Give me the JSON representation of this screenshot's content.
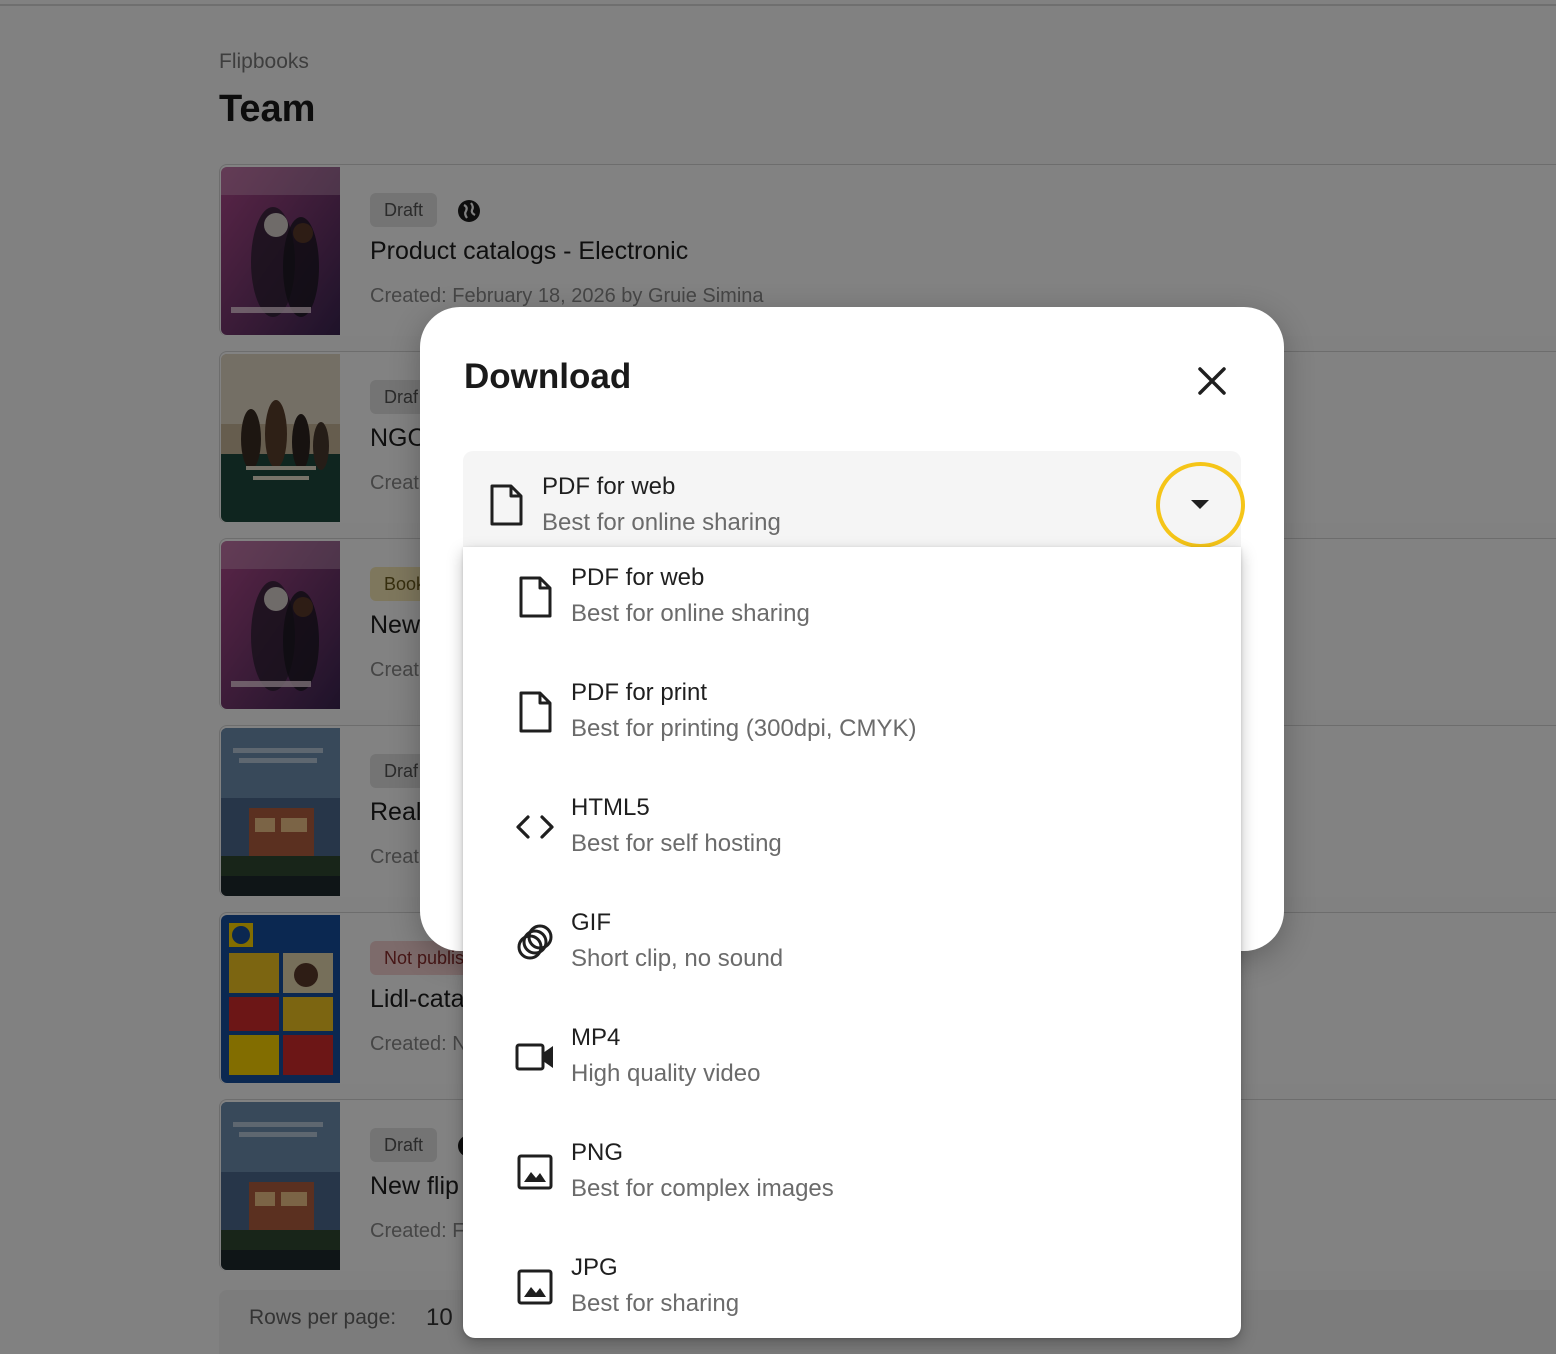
{
  "header": {
    "breadcrumb": "Flipbooks",
    "title": "Team"
  },
  "flipbooks": [
    {
      "status": "Draft",
      "status_type": "draft",
      "title": "Product catalogs - Electronic",
      "meta": "Created: February 18, 2026 by Gruie Simina",
      "has_globe": true,
      "cover": "electronics"
    },
    {
      "status": "Draf",
      "status_type": "draft",
      "title": "NGO",
      "meta": "Creat",
      "has_globe": false,
      "cover": "charity"
    },
    {
      "status": "Book",
      "status_type": "book",
      "title": "New",
      "meta": "Creat",
      "has_globe": false,
      "cover": "electronics"
    },
    {
      "status": "Draf",
      "status_type": "draft",
      "title": "Real",
      "meta": "Creat",
      "has_globe": false,
      "cover": "realty"
    },
    {
      "status": "Not publis",
      "status_type": "notpub",
      "title": "Lidl-cata",
      "meta": "Created: N",
      "has_globe": false,
      "cover": "lidl"
    },
    {
      "status": "Draft",
      "status_type": "draft",
      "title": "New flip",
      "meta": "Created: F",
      "has_globe": true,
      "cover": "realty"
    }
  ],
  "pagination": {
    "rows_label": "Rows per page:",
    "rows_value": "10"
  },
  "dialog": {
    "title": "Download",
    "selected": {
      "title": "PDF for web",
      "subtitle": "Best for online sharing",
      "icon": "file-icon"
    },
    "highlight_color": "#f5c518",
    "options": [
      {
        "title": "PDF for web",
        "subtitle": "Best for online sharing",
        "icon": "file-icon"
      },
      {
        "title": "PDF for print",
        "subtitle": "Best for printing (300dpi, CMYK)",
        "icon": "file-icon"
      },
      {
        "title": "HTML5",
        "subtitle": "Best for self hosting",
        "icon": "code-icon"
      },
      {
        "title": "GIF",
        "subtitle": "Short clip, no sound",
        "icon": "gif-icon"
      },
      {
        "title": "MP4",
        "subtitle": "High quality video",
        "icon": "video-icon"
      },
      {
        "title": "PNG",
        "subtitle": "Best for complex images",
        "icon": "image-icon"
      },
      {
        "title": "JPG",
        "subtitle": "Best for sharing",
        "icon": "image-icon"
      }
    ]
  }
}
